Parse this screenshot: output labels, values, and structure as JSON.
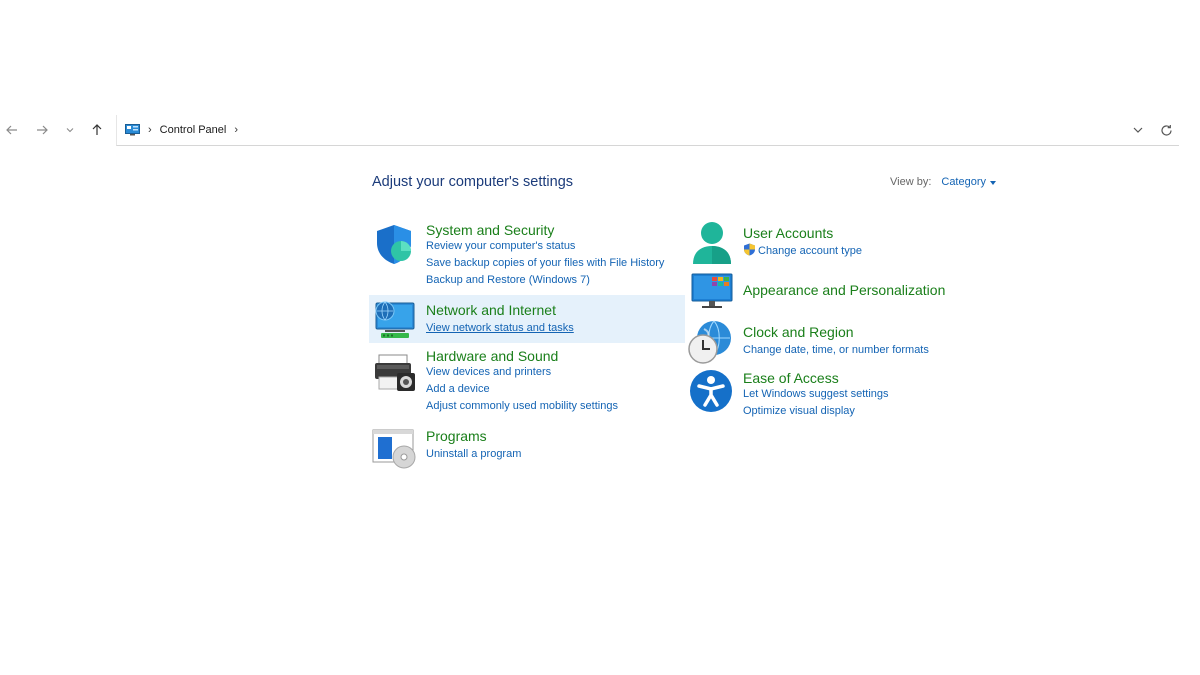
{
  "address": {
    "crumbs": [
      "Control Panel"
    ]
  },
  "heading": "Adjust your computer's settings",
  "view_by": {
    "label": "View by:",
    "value": "Category"
  },
  "left_categories": [
    {
      "title": "System and Security",
      "links": [
        "Review your computer's status",
        "Save backup copies of your files with File History",
        "Backup and Restore (Windows 7)"
      ],
      "icon": "shield-icon"
    },
    {
      "title": "Network and Internet",
      "links": [
        "View network status and tasks"
      ],
      "icon": "network-icon"
    },
    {
      "title": "Hardware and Sound",
      "links": [
        "View devices and printers",
        "Add a device",
        "Adjust commonly used mobility settings"
      ],
      "icon": "printer-icon"
    },
    {
      "title": "Programs",
      "links": [
        "Uninstall a program"
      ],
      "icon": "programs-icon"
    }
  ],
  "right_categories": [
    {
      "title": "User Accounts",
      "links": [
        "Change account type"
      ],
      "icon": "user-icon"
    },
    {
      "title": "Appearance and Personalization",
      "links": [],
      "icon": "monitor-icon"
    },
    {
      "title": "Clock and Region",
      "links": [
        "Change date, time, or number formats"
      ],
      "icon": "clock-globe-icon"
    },
    {
      "title": "Ease of Access",
      "links": [
        "Let Windows suggest settings",
        "Optimize visual display"
      ],
      "icon": "accessibility-icon"
    }
  ],
  "colors": {
    "title_green": "#1a7f1a",
    "link_blue": "#1464b4",
    "heading_blue": "#1b3b7a",
    "hover_bg": "#e5f1fb"
  }
}
